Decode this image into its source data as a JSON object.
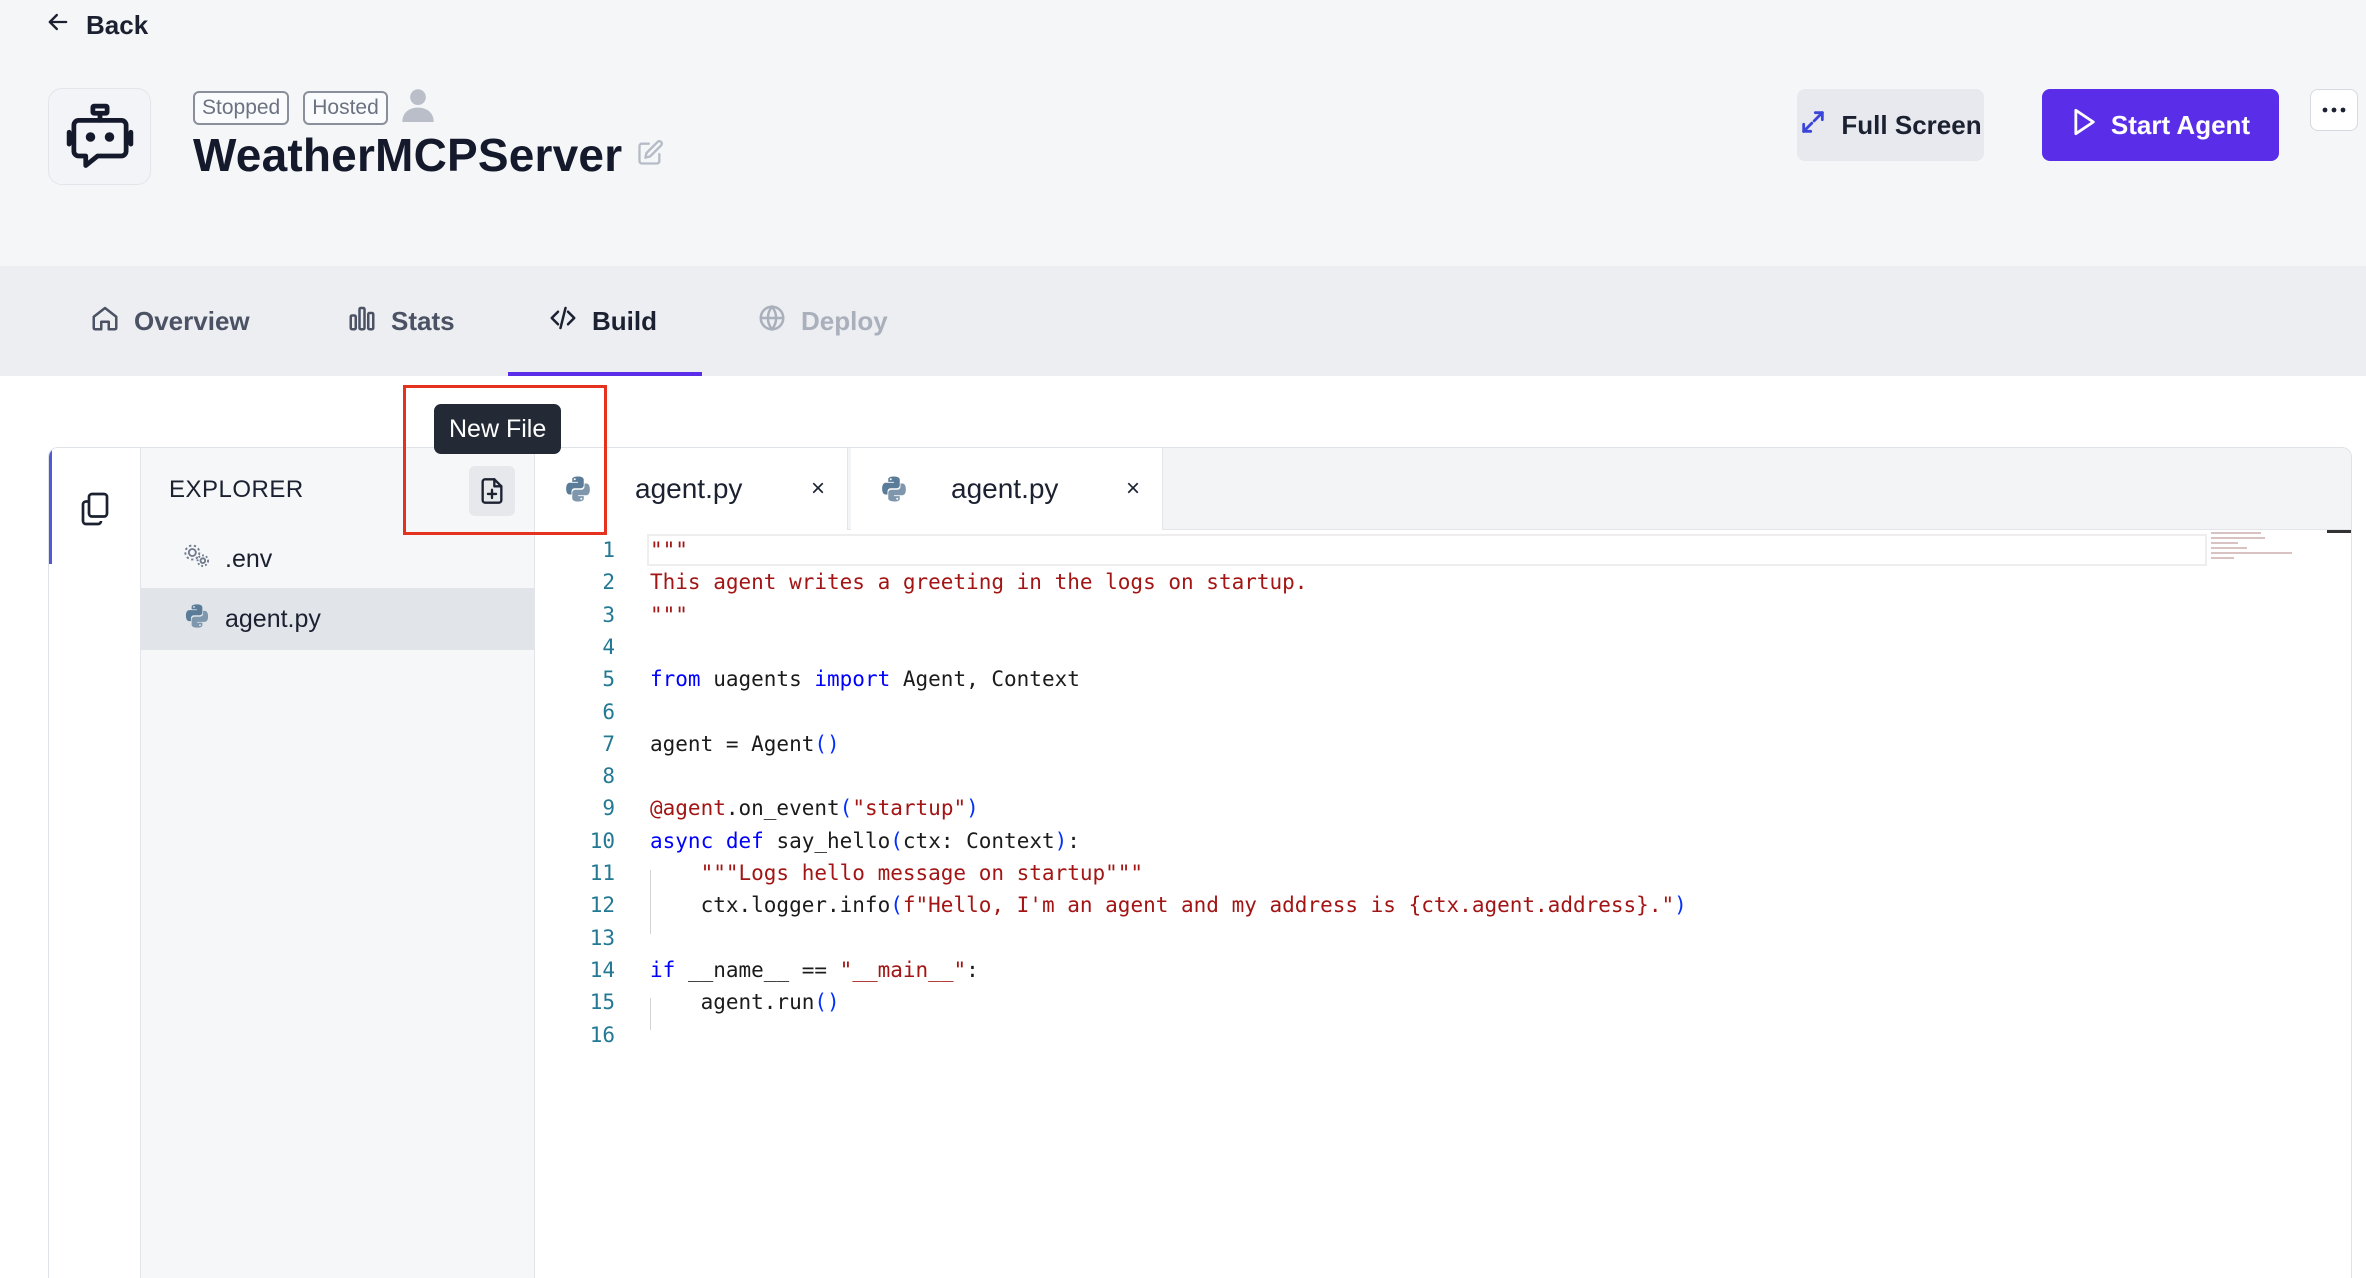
{
  "header": {
    "back_label": "Back",
    "badges": [
      "Stopped",
      "Hosted"
    ],
    "agent_name": "WeatherMCPServer",
    "full_screen_label": "Full Screen",
    "start_agent_label": "Start Agent"
  },
  "tabs": [
    {
      "label": "Overview",
      "icon": "home-icon",
      "state": "normal"
    },
    {
      "label": "Stats",
      "icon": "bar-chart-icon",
      "state": "normal"
    },
    {
      "label": "Build",
      "icon": "code-icon",
      "state": "active"
    },
    {
      "label": "Deploy",
      "icon": "globe-icon",
      "state": "disabled"
    }
  ],
  "explorer": {
    "title": "EXPLORER",
    "tooltip": "New File",
    "files": [
      {
        "name": ".env",
        "icon": "settings-gears-icon",
        "selected": false
      },
      {
        "name": "agent.py",
        "icon": "python-icon",
        "selected": true
      }
    ]
  },
  "editor": {
    "tabs": [
      {
        "name": "agent.py",
        "close": "×"
      },
      {
        "name": "agent.py",
        "close": "×"
      }
    ],
    "line_numbers": [
      "1",
      "2",
      "3",
      "4",
      "5",
      "6",
      "7",
      "8",
      "9",
      "10",
      "11",
      "12",
      "13",
      "14",
      "15",
      "16"
    ],
    "code_lines": [
      "\"\"\"",
      "This agent writes a greeting in the logs on startup.",
      "\"\"\"",
      "",
      "from uagents import Agent, Context",
      "",
      "agent = Agent()",
      "",
      "@agent.on_event(\"startup\")",
      "async def say_hello(ctx: Context):",
      "    \"\"\"Logs hello message on startup\"\"\"",
      "    ctx.logger.info(f\"Hello, I'm an agent and my address is {ctx.agent.address}.\")",
      "",
      "if __name__ == \"__main__\":",
      "    agent.run()",
      ""
    ]
  },
  "colors": {
    "accent": "#5a2ee8",
    "highlight": "#e5321e",
    "keyword": "#0000ff",
    "string": "#a31515"
  }
}
